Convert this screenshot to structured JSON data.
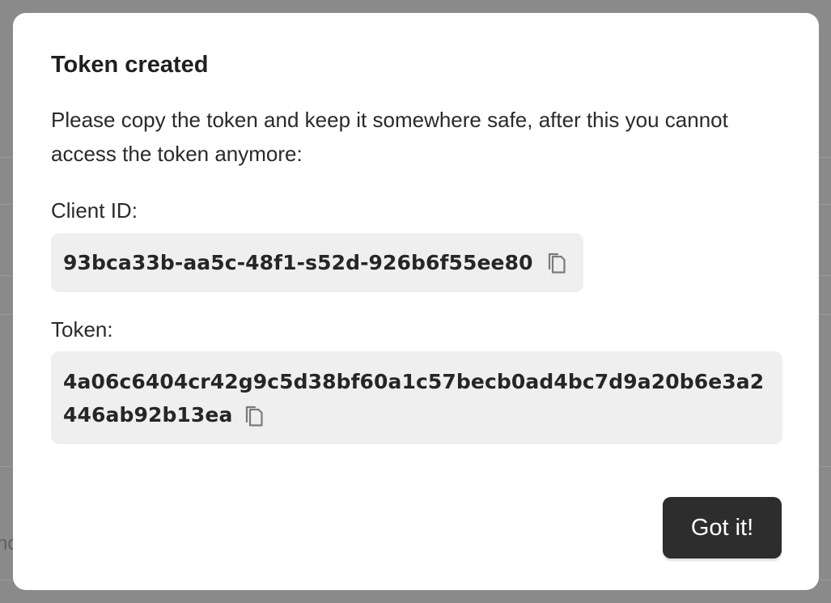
{
  "background": {
    "fragment_text": "nc"
  },
  "modal": {
    "title": "Token created",
    "description": "Please copy the token and keep it somewhere safe, after this you cannot access the token anymore:",
    "client_id": {
      "label": "Client ID:",
      "value": "93bca33b-aa5c-48f1-s52d-926b6f55ee80",
      "copy_icon": "copy-icon"
    },
    "token": {
      "label": "Token:",
      "value": "4a06c6404cr42g9c5d38bf60a1c57becb0ad4bc7d9a20b6e3a2446ab92b13ea",
      "copy_icon": "copy-icon"
    },
    "confirm_button": "Got it!"
  },
  "colors": {
    "overlay": "#8a8a8a",
    "modal_bg": "#ffffff",
    "code_bg": "#efefef",
    "button_bg": "#2d2d2d",
    "button_text": "#ffffff"
  }
}
